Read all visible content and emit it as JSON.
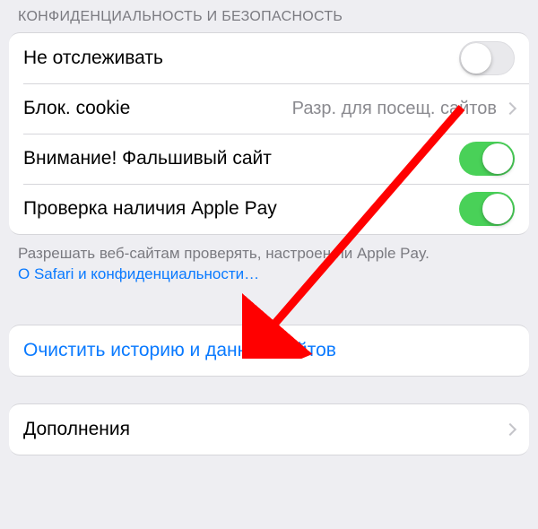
{
  "section_header": "КОНФИДЕНЦИАЛЬНОСТЬ И БЕЗОПАСНОСТЬ",
  "rows": {
    "do_not_track": {
      "label": "Не отслеживать",
      "on": false
    },
    "block_cookie": {
      "label": "Блок. cookie",
      "value": "Разр. для посещ. сайтов"
    },
    "fraud_warning": {
      "label": "Внимание! Фальшивый сайт",
      "on": true
    },
    "apple_pay_check": {
      "label": "Проверка наличия Apple Pay",
      "on": true
    }
  },
  "footer": {
    "text": "Разрешать веб-сайтам проверять, настроен ли Apple Pay.",
    "link": "О Safari и конфиденциальности…"
  },
  "clear_history": "Очистить историю и данные сайтов",
  "extensions": "Дополнения",
  "colors": {
    "accent": "#0a7aff",
    "toggle_on": "#49d158",
    "arrow": "#ff0000"
  }
}
